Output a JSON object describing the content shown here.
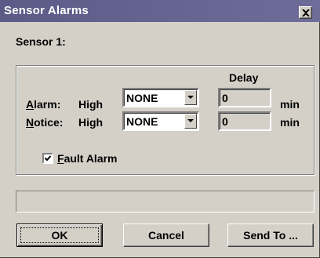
{
  "window": {
    "title": "Sensor Alarms"
  },
  "sensor_label": "Sensor 1:",
  "delay_header": "Delay",
  "rows": [
    {
      "label_accel": "A",
      "label_rest": "larm:",
      "level": "High",
      "select_value": "NONE",
      "delay_value": "0",
      "unit": "min"
    },
    {
      "label_accel": "N",
      "label_rest": "otice:",
      "level": "High",
      "select_value": "NONE",
      "delay_value": "0",
      "unit": "min"
    }
  ],
  "fault_alarm": {
    "accel": "F",
    "rest": "ault Alarm",
    "checked": true
  },
  "status_text": "",
  "buttons": {
    "ok": "OK",
    "cancel": "Cancel",
    "send_to": "Send To ..."
  }
}
